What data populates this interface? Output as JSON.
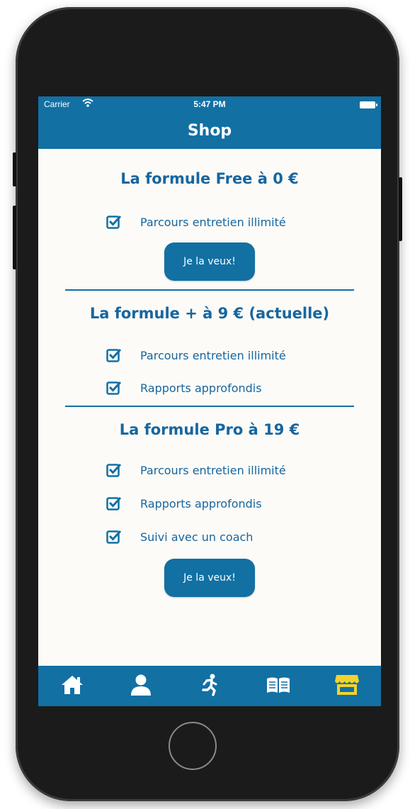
{
  "status_bar": {
    "carrier": "Carrier",
    "time": "5:47 PM"
  },
  "navbar": {
    "title": "Shop"
  },
  "plans": [
    {
      "title": "La formule Free à 0 €",
      "features": [
        "Parcours entretien illimité"
      ],
      "button": "Je la veux!"
    },
    {
      "title": "La formule + à 9 € (actuelle)",
      "features": [
        "Parcours entretien illimité",
        "Rapports approfondis"
      ]
    },
    {
      "title": "La formule Pro à 19 €",
      "features": [
        "Parcours entretien illimité",
        "Rapports approfondis",
        "Suivi avec un coach"
      ],
      "button": "Je la veux!"
    }
  ],
  "tabs": [
    {
      "icon": "home-icon",
      "active": false
    },
    {
      "icon": "user-icon",
      "active": false
    },
    {
      "icon": "running-icon",
      "active": false
    },
    {
      "icon": "book-icon",
      "active": false
    },
    {
      "icon": "store-icon",
      "active": true
    }
  ],
  "colors": {
    "primary": "#1270a3",
    "text": "#1666a0",
    "background": "#fcfbf7",
    "active_tab": "#f2d32e"
  }
}
